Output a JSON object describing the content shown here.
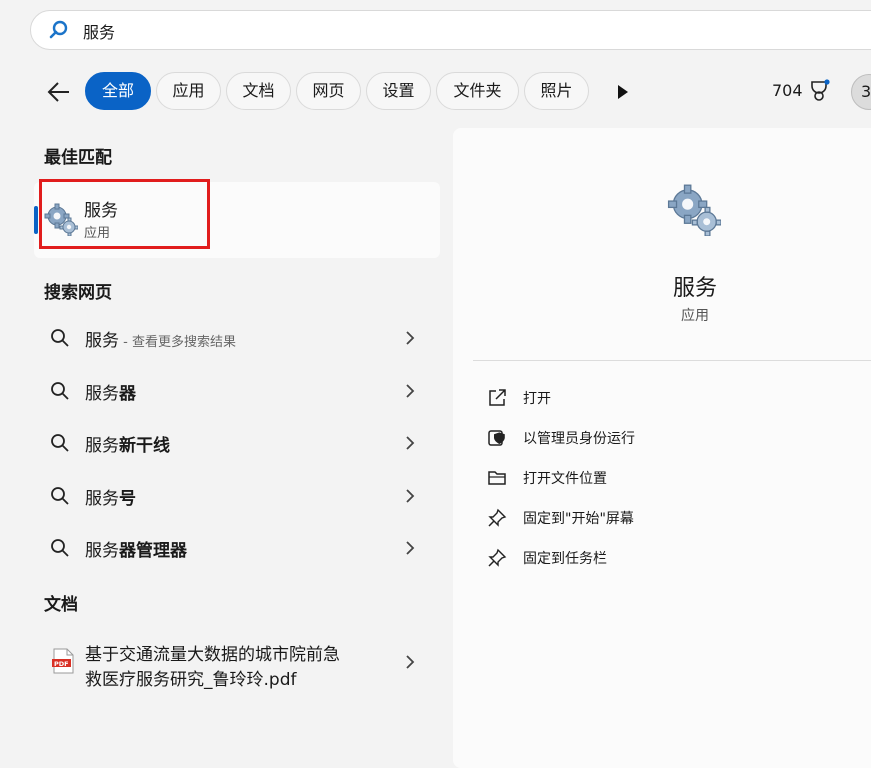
{
  "search": {
    "query": "服务"
  },
  "filters": {
    "chips": [
      "全部",
      "应用",
      "文档",
      "网页",
      "设置",
      "文件夹",
      "照片"
    ],
    "score": "704",
    "avatar_text": "3"
  },
  "best_match": {
    "heading": "最佳匹配",
    "name": "服务",
    "type": "应用"
  },
  "web": {
    "heading": "搜索网页",
    "items": [
      {
        "prefix": "服务",
        "bold": "",
        "hint": " - 查看更多搜索结果"
      },
      {
        "prefix": "服务",
        "bold": "器",
        "hint": ""
      },
      {
        "prefix": "服务",
        "bold": "新干线",
        "hint": ""
      },
      {
        "prefix": "服务",
        "bold": "号",
        "hint": ""
      },
      {
        "prefix": "服务",
        "bold": "器管理器",
        "hint": ""
      }
    ]
  },
  "documents": {
    "heading": "文档",
    "item_line1": "基于交通流量大数据的城市院前急",
    "item_line2": "救医疗服务研究_鲁玲玲.pdf"
  },
  "panel": {
    "title": "服务",
    "subtitle": "应用",
    "actions": [
      {
        "label": "打开",
        "icon": "open-external-icon"
      },
      {
        "label": "以管理员身份运行",
        "icon": "shield-icon"
      },
      {
        "label": "打开文件位置",
        "icon": "folder-icon"
      },
      {
        "label": "固定到\"开始\"屏幕",
        "icon": "pin-icon"
      },
      {
        "label": "固定到任务栏",
        "icon": "pin-icon"
      }
    ]
  },
  "colors": {
    "accent": "#0a63c6",
    "highlight": "#e11d1d"
  }
}
